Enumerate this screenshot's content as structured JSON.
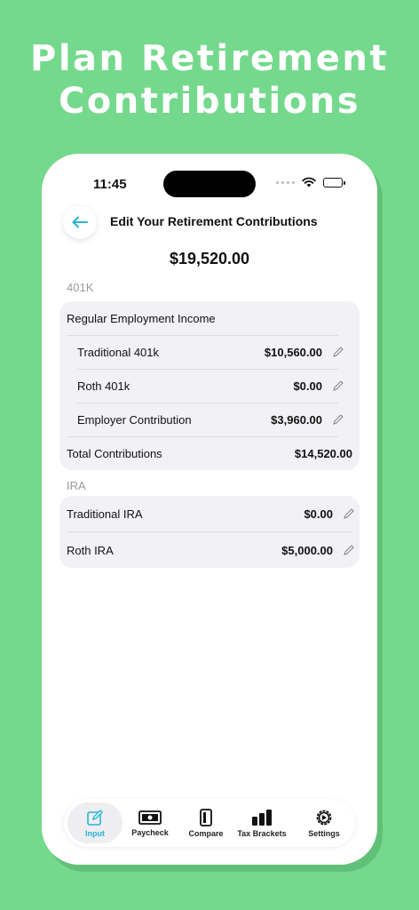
{
  "headline": {
    "line1": "Plan Retirement",
    "line2": "Contributions"
  },
  "status": {
    "time": "11:45"
  },
  "nav": {
    "title": "Edit Your Retirement Contributions"
  },
  "total": "$19,520.00",
  "sections": {
    "k401": {
      "label": "401K",
      "group_title": "Regular Employment Income",
      "rows": [
        {
          "label": "Traditional 401k",
          "value": "$10,560.00"
        },
        {
          "label": "Roth 401k",
          "value": "$0.00"
        },
        {
          "label": "Employer Contribution",
          "value": "$3,960.00"
        }
      ],
      "total_label": "Total Contributions",
      "total_value": "$14,520.00"
    },
    "ira": {
      "label": "IRA",
      "rows": [
        {
          "label": "Traditional IRA",
          "value": "$0.00"
        },
        {
          "label": "Roth IRA",
          "value": "$5,000.00"
        }
      ]
    }
  },
  "tabs": [
    {
      "label": "Input",
      "icon": "edit-icon"
    },
    {
      "label": "Paycheck",
      "icon": "money-icon"
    },
    {
      "label": "Compare",
      "icon": "phone-icon"
    },
    {
      "label": "Tax Brackets",
      "icon": "bar-chart-icon"
    },
    {
      "label": "Settings",
      "icon": "gear-icon"
    }
  ],
  "colors": {
    "background": "#74d98c",
    "accent": "#2ab3d6",
    "card": "#f2f2f6"
  }
}
